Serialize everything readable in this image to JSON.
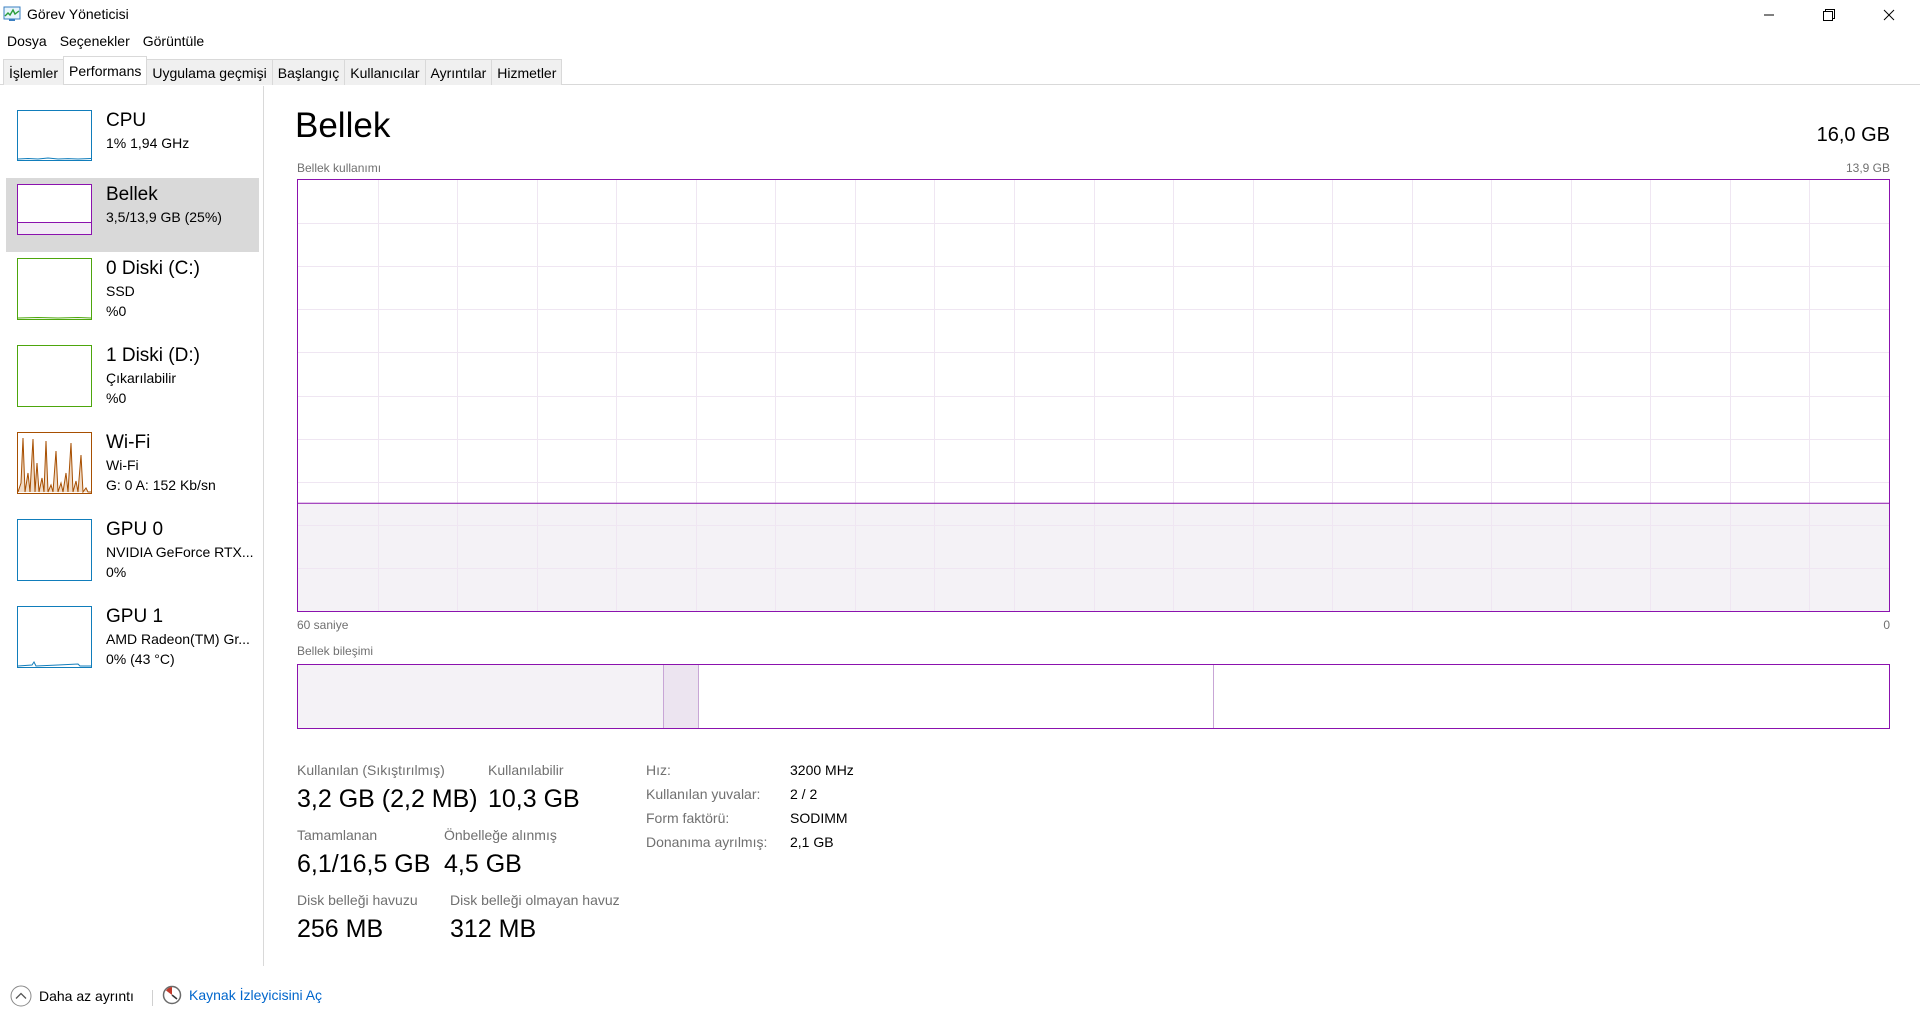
{
  "window": {
    "title": "Görev Yöneticisi"
  },
  "menu": [
    "Dosya",
    "Seçenekler",
    "Görüntüle"
  ],
  "tabs": [
    "İşlemler",
    "Performans",
    "Uygulama geçmişi",
    "Başlangıç",
    "Kullanıcılar",
    "Ayrıntılar",
    "Hizmetler"
  ],
  "active_tab": "Performans",
  "sidebar": [
    {
      "title": "CPU",
      "lines": [
        "1% 1,94 GHz"
      ],
      "color": "#117dbb",
      "selected": false
    },
    {
      "title": "Bellek",
      "lines": [
        "3,5/13,9 GB (25%)"
      ],
      "color": "#8b12ae",
      "selected": true
    },
    {
      "title": "0 Diski (C:)",
      "lines": [
        "SSD",
        "%0"
      ],
      "color": "#4da60c",
      "selected": false
    },
    {
      "title": "1 Diski (D:)",
      "lines": [
        "Çıkarılabilir",
        "%0"
      ],
      "color": "#4da60c",
      "selected": false
    },
    {
      "title": "Wi-Fi",
      "lines": [
        "Wi-Fi",
        "G: 0 A: 152 Kb/sn"
      ],
      "color": "#a74f01",
      "selected": false
    },
    {
      "title": "GPU 0",
      "lines": [
        "NVIDIA GeForce RTX...",
        "0%"
      ],
      "color": "#117dbb",
      "selected": false
    },
    {
      "title": "GPU 1",
      "lines": [
        "AMD Radeon(TM) Gr...",
        "0% (43 °C)"
      ],
      "color": "#117dbb",
      "selected": false
    }
  ],
  "main": {
    "title": "Bellek",
    "total": "16,0 GB",
    "chart_label": "Bellek kullanımı",
    "chart_max": "13,9 GB",
    "chart_x_left": "60 saniye",
    "chart_x_right": "0",
    "composition_label": "Bellek bileşimi",
    "usage_percent": 25,
    "composition": {
      "in_use_gb": 3.2,
      "modified_gb": 0.3,
      "standby_gb": 4.5,
      "total_gb": 13.9
    },
    "stats": [
      {
        "label": "Kullanılan (Sıkıştırılmış)",
        "value": "3,2 GB (2,2 MB)"
      },
      {
        "label": "Kullanılabilir",
        "value": "10,3 GB"
      },
      {
        "label": "Tamamlanan",
        "value": "6,1/16,5 GB"
      },
      {
        "label": "Önbelleğe alınmış",
        "value": "4,5 GB"
      },
      {
        "label": "Disk belleği havuzu",
        "value": "256 MB"
      },
      {
        "label": "Disk belleği olmayan havuz",
        "value": "312 MB"
      }
    ],
    "properties": [
      {
        "label": "Hız:",
        "value": "3200 MHz"
      },
      {
        "label": "Kullanılan yuvalar:",
        "value": "2 / 2"
      },
      {
        "label": "Form faktörü:",
        "value": "SODIMM"
      },
      {
        "label": "Donanıma ayrılmış:",
        "value": "2,1 GB"
      }
    ]
  },
  "footer": {
    "fewer_details": "Daha az ayrıntı",
    "open_resmon": "Kaynak İzleyicisini Aç"
  },
  "colors": {
    "memory": "#8b12ae",
    "memory_fill": "#f4f2f6",
    "grid": "#efe6f2",
    "cpu": "#117dbb",
    "disk": "#4da60c",
    "wifi": "#a74f01"
  }
}
